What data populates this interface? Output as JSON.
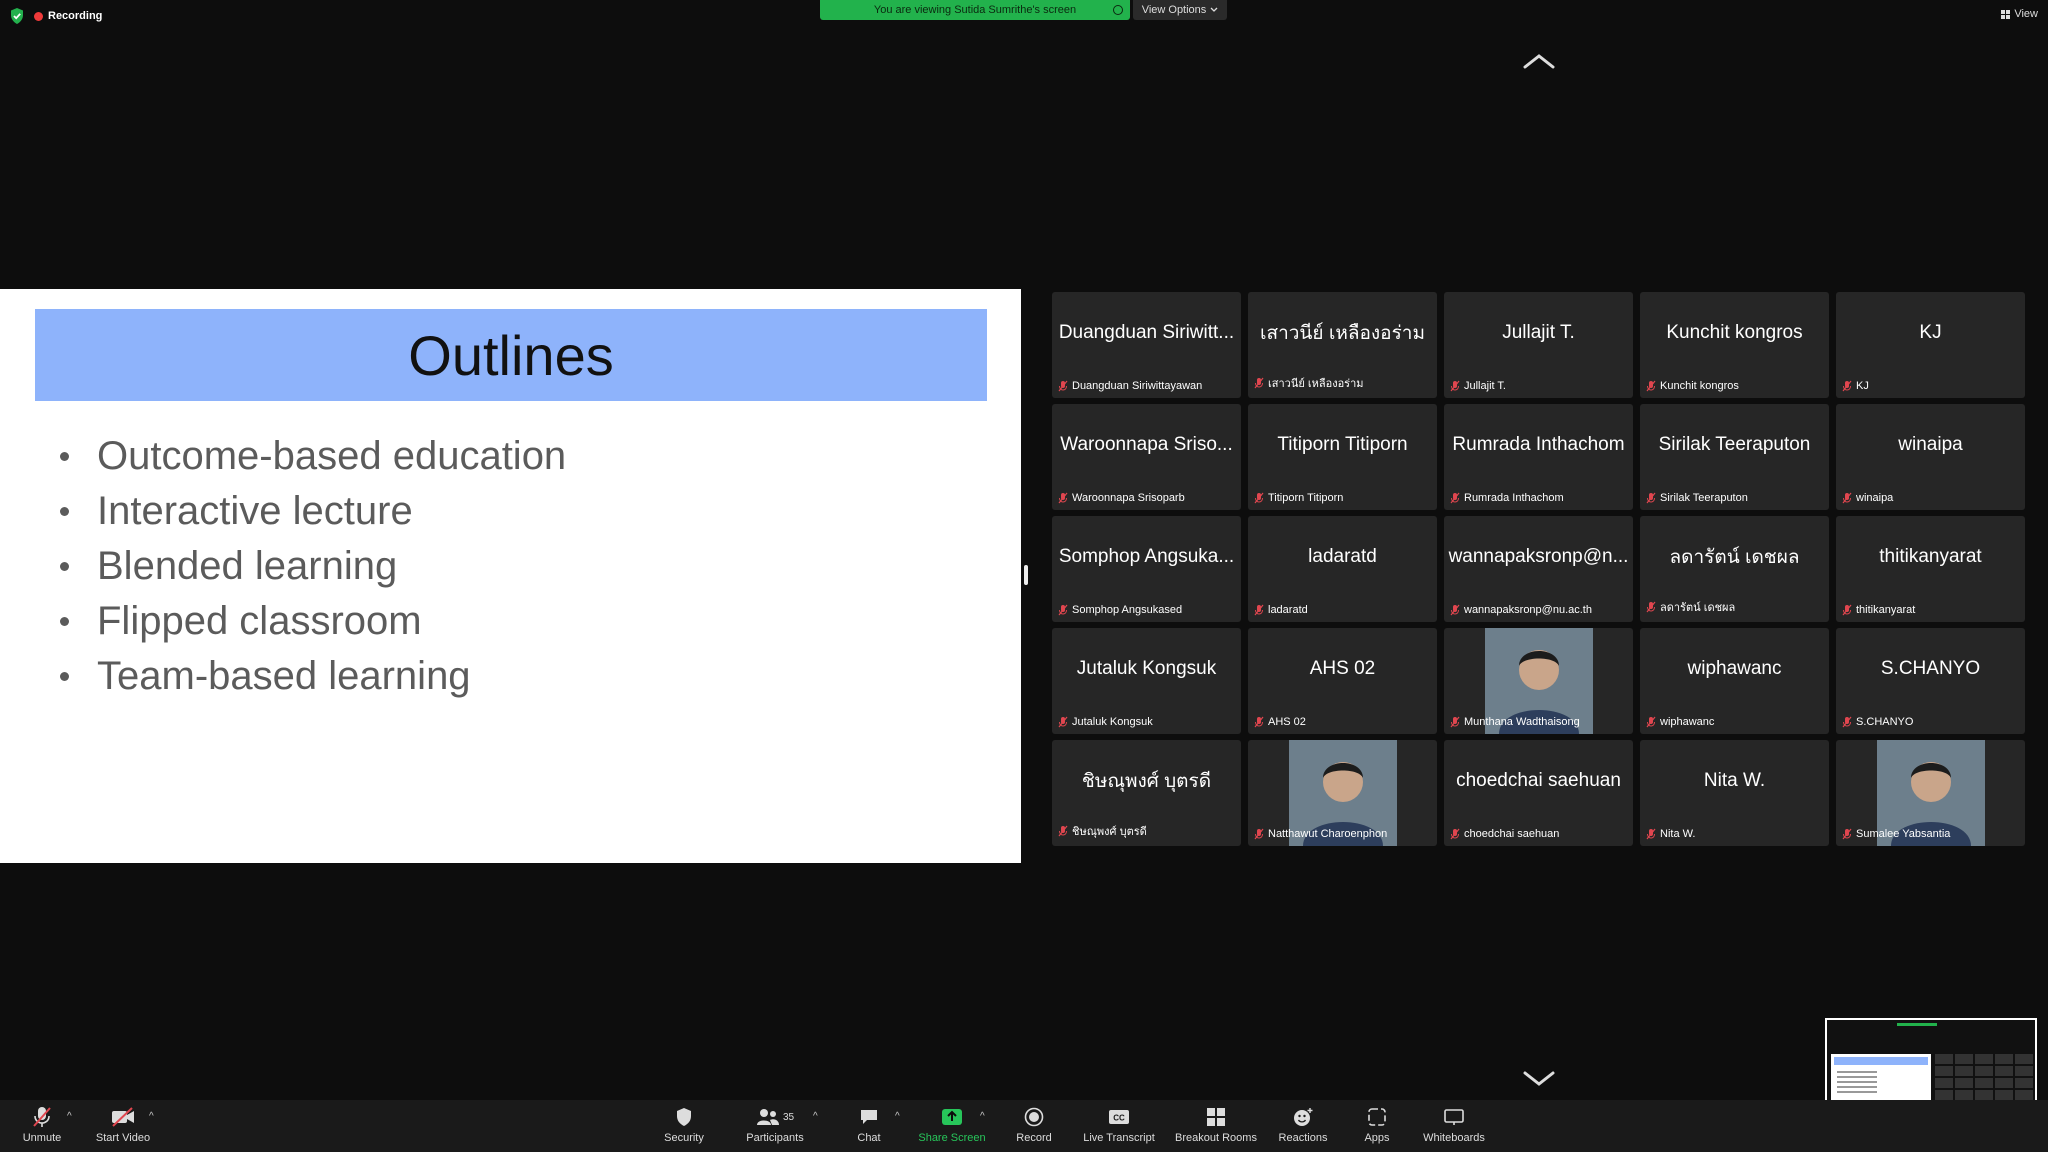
{
  "meeting": {
    "recording_label": "Recording",
    "share_banner": "You are viewing Sutida Sumrithe's screen",
    "view_options": "View Options",
    "view_label": "View"
  },
  "slide": {
    "title": "Outlines",
    "bullets": [
      "Outcome-based education",
      "Interactive lecture",
      "Blended learning",
      "Flipped classroom",
      "Team-based learning"
    ]
  },
  "participants": [
    {
      "display": "Duangduan Siriwitt...",
      "label": "Duangduan Siriwittayawan"
    },
    {
      "display": "เสาวนีย์ เหลืองอร่าม",
      "label": "เสาวนีย์ เหลืองอร่าม"
    },
    {
      "display": "Jullajit T.",
      "label": "Jullajit T."
    },
    {
      "display": "Kunchit kongros",
      "label": "Kunchit kongros"
    },
    {
      "display": "KJ",
      "label": "KJ"
    },
    {
      "display": "Waroonnapa Sriso...",
      "label": "Waroonnapa Srisoparb"
    },
    {
      "display": "Titiporn Titiporn",
      "label": "Titiporn Titiporn"
    },
    {
      "display": "Rumrada Inthachom",
      "label": "Rumrada Inthachom"
    },
    {
      "display": "Sirilak Teeraputon",
      "label": "Sirilak Teeraputon"
    },
    {
      "display": "winaipa",
      "label": "winaipa"
    },
    {
      "display": "Somphop Angsuka...",
      "label": "Somphop Angsukased"
    },
    {
      "display": "ladaratd",
      "label": "ladaratd"
    },
    {
      "display": "wannapaksronp@n...",
      "label": "wannapaksronp@nu.ac.th"
    },
    {
      "display": "ลดารัตน์ เดชผล",
      "label": "ลดารัตน์ เดชผล"
    },
    {
      "display": "thitikanyarat",
      "label": "thitikanyarat"
    },
    {
      "display": "Jutaluk Kongsuk",
      "label": "Jutaluk Kongsuk"
    },
    {
      "display": "AHS 02",
      "label": "AHS 02"
    },
    {
      "display": "",
      "label": "Munthana Wadthaisong",
      "photo": true
    },
    {
      "display": "wiphawanc",
      "label": "wiphawanc"
    },
    {
      "display": "S.CHANYO",
      "label": "S.CHANYO"
    },
    {
      "display": "ชิษณุพงศ์ บุตรดี",
      "label": "ชิษณุพงศ์ บุตรดี"
    },
    {
      "display": "",
      "label": "Natthawut Charoenphon",
      "photo": true
    },
    {
      "display": "choedchai saehuan",
      "label": "choedchai saehuan"
    },
    {
      "display": "Nita W.",
      "label": "Nita W."
    },
    {
      "display": "",
      "label": "Sumalee Yabsantia",
      "photo": true
    }
  ],
  "toolbar": {
    "unmute": "Unmute",
    "start_video": "Start Video",
    "security": "Security",
    "participants": "Participants",
    "participant_count": "35",
    "chat": "Chat",
    "share_screen": "Share Screen",
    "record": "Record",
    "live_transcript": "Live Transcript",
    "breakout_rooms": "Breakout Rooms",
    "reactions": "Reactions",
    "apps": "Apps",
    "whiteboards": "Whiteboards"
  },
  "colors": {
    "share_green": "#22b24c",
    "slide_title_bg": "#8eb3fb",
    "mute_red": "#e0464f",
    "recording_red": "#ef3a3a"
  }
}
